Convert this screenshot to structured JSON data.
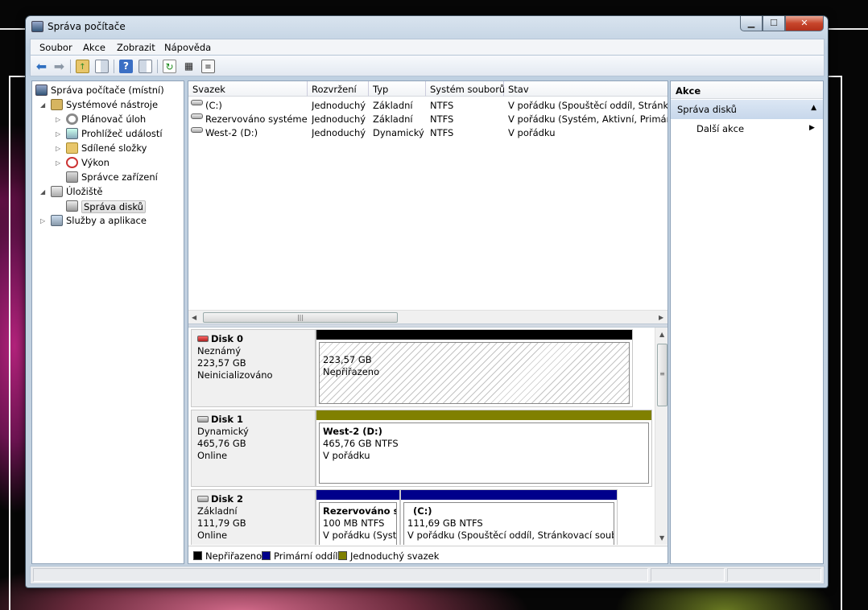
{
  "window": {
    "title": "Správa počítače"
  },
  "menu": [
    "Soubor",
    "Akce",
    "Zobrazit",
    "Nápověda"
  ],
  "toolbar": {
    "buttons": [
      "back-icon",
      "forward-icon",
      "up-folder-icon",
      "show-hide-tree-icon",
      "help-icon",
      "show-hide-action-icon",
      "refresh-icon",
      "properties-icon",
      "export-list-icon"
    ]
  },
  "tree": {
    "root": "Správa počítače (místní)",
    "system_tools": "Systémové nástroje",
    "task_scheduler": "Plánovač úloh",
    "event_viewer": "Prohlížeč událostí",
    "shared_folders": "Sdílené složky",
    "performance": "Výkon",
    "device_manager": "Správce zařízení",
    "storage": "Úložiště",
    "disk_management": "Správa disků",
    "services_apps": "Služby a aplikace"
  },
  "volumes": {
    "columns": [
      "Svazek",
      "Rozvržení",
      "Typ",
      "Systém souborů",
      "Stav"
    ],
    "rows": [
      [
        "(C:)",
        "Jednoduchý",
        "Základní",
        "NTFS",
        "V pořádku (Spouštěcí oddíl, Stránkova"
      ],
      [
        "Rezervováno systémem",
        "Jednoduchý",
        "Základní",
        "NTFS",
        "V pořádku (Systém, Aktivní, Primární"
      ],
      [
        "West-2 (D:)",
        "Jednoduchý",
        "Dynamický",
        "NTFS",
        "V pořádku"
      ]
    ]
  },
  "disks": [
    {
      "name": "Disk 0",
      "kind": "Neznámý",
      "size": "223,57 GB",
      "status": "Neinicializováno",
      "partitions": [
        {
          "title": "",
          "line1": "223,57 GB",
          "line2": "Nepřiřazeno",
          "bar_color": "#000000"
        }
      ]
    },
    {
      "name": "Disk 1",
      "kind": "Dynamický",
      "size": "465,76 GB",
      "status": "Online",
      "partitions": [
        {
          "title": "West-2  (D:)",
          "line1": "465,76 GB NTFS",
          "line2": "V pořádku",
          "bar_color": "#808000"
        }
      ]
    },
    {
      "name": "Disk 2",
      "kind": "Základní",
      "size": "111,79 GB",
      "status": "Online",
      "partitions": [
        {
          "title": "Rezervováno sy",
          "line1": "100 MB NTFS",
          "line2": "V pořádku (Systé",
          "bar_color": "#00008b"
        },
        {
          "title": "(C:)",
          "line1": "111,69 GB NTFS",
          "line2": "V pořádku (Spouštěcí oddíl, Stránkovací soubor,",
          "bar_color": "#00008b"
        }
      ]
    }
  ],
  "legend": [
    {
      "label": "Nepřiřazeno",
      "color": "#000000"
    },
    {
      "label": "Primární oddíl",
      "color": "#00008b"
    },
    {
      "label": "Jednoduchý svazek",
      "color": "#808000"
    }
  ],
  "actions": {
    "header": "Akce",
    "section": "Správa disků",
    "more": "Další akce"
  }
}
